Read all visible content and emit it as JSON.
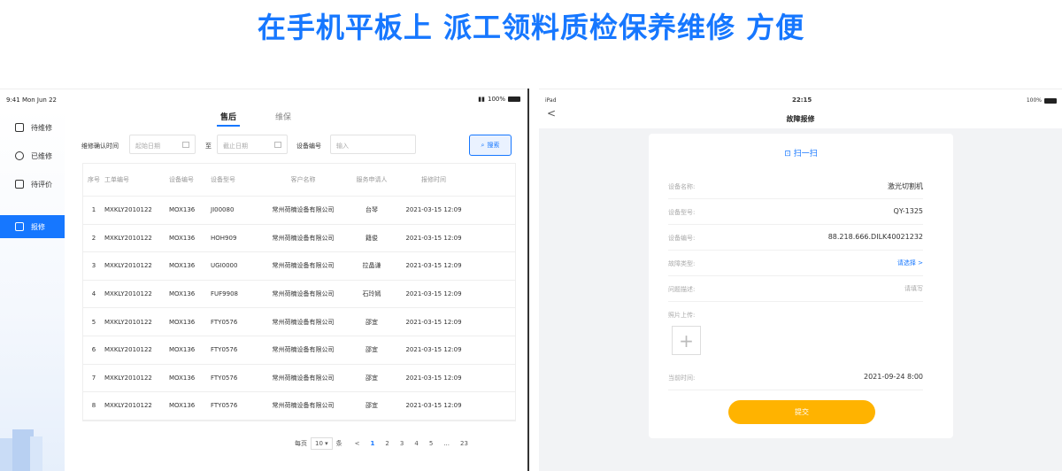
{
  "headline": "在手机平板上 派工领料质检保养维修 方便",
  "left": {
    "status": {
      "time": "9:41 Mon Jun 22",
      "right": "100%"
    },
    "sidebar": {
      "items": [
        {
          "label": "待维修",
          "icon": "clipboard-icon"
        },
        {
          "label": "已维修",
          "icon": "gear-icon"
        },
        {
          "label": "待评价",
          "icon": "monitor-icon"
        },
        {
          "label": "报修",
          "icon": "report-icon"
        }
      ],
      "active_index": 3
    },
    "tabs": [
      {
        "label": "售后"
      },
      {
        "label": "维保"
      }
    ],
    "active_tab": 0,
    "filter": {
      "confirm_time_label": "维修确认时间",
      "start_placeholder": "起始日期",
      "to_label": "至",
      "end_placeholder": "截止日期",
      "device_no_label": "设备编号",
      "device_no_placeholder": "输入",
      "search_label": "搜索"
    },
    "table": {
      "headers": [
        "序号",
        "工单编号",
        "设备编号",
        "设备型号",
        "客户名称",
        "服务申请人",
        "报修时间"
      ],
      "rows": [
        [
          "1",
          "MXKLY2010122",
          "MOX136",
          "JI00080",
          "常州荷楠设备有限公司",
          "台琴",
          "2021-03-15 12:09"
        ],
        [
          "2",
          "MXKLY2010122",
          "MOX136",
          "HOH909",
          "常州荷楠设备有限公司",
          "籍俊",
          "2021-03-15 12:09"
        ],
        [
          "3",
          "MXKLY2010122",
          "MOX136",
          "UGI0000",
          "常州荷楠设备有限公司",
          "拉晶谦",
          "2021-03-15 12:09"
        ],
        [
          "4",
          "MXKLY2010122",
          "MOX136",
          "FUF9908",
          "常州荷楠设备有限公司",
          "石玲嫣",
          "2021-03-15 12:09"
        ],
        [
          "5",
          "MXKLY2010122",
          "MOX136",
          "FTY0576",
          "常州荷楠设备有限公司",
          "邵宜",
          "2021-03-15 12:09"
        ],
        [
          "6",
          "MXKLY2010122",
          "MOX136",
          "FTY0576",
          "常州荷楠设备有限公司",
          "邵宜",
          "2021-03-15 12:09"
        ],
        [
          "7",
          "MXKLY2010122",
          "MOX136",
          "FTY0576",
          "常州荷楠设备有限公司",
          "邵宜",
          "2021-03-15 12:09"
        ],
        [
          "8",
          "MXKLY2010122",
          "MOX136",
          "FTY0576",
          "常州荷楠设备有限公司",
          "邵宜",
          "2021-03-15 12:09"
        ]
      ]
    },
    "pager": {
      "per_page_label": "每页",
      "per_page_value": "10",
      "per_page_unit": "条",
      "prev": "<",
      "pages": [
        "1",
        "2",
        "3",
        "4",
        "5",
        "...",
        "23"
      ],
      "current": "1"
    }
  },
  "right": {
    "status": {
      "left": "iPad",
      "time": "22:15",
      "right": "100%"
    },
    "back": "<",
    "title": "故障报修",
    "scan_label": "扫一扫",
    "fields": [
      {
        "key": "设备名称:",
        "value": "激光切割机",
        "type": "value"
      },
      {
        "key": "设备型号:",
        "value": "QY-1325",
        "type": "value"
      },
      {
        "key": "设备编号:",
        "value": "88.218.666.DILK40021232",
        "type": "value"
      },
      {
        "key": "故障类型:",
        "value": "请选择 >",
        "type": "link"
      },
      {
        "key": "问题描述:",
        "value": "请填写",
        "type": "ph"
      },
      {
        "key": "照片上传:",
        "value": "",
        "type": "none"
      },
      {
        "key": "当前时间:",
        "value": "2021-09-24 8:00",
        "type": "value"
      }
    ],
    "upload_symbol": "+",
    "submit_label": "提交"
  }
}
